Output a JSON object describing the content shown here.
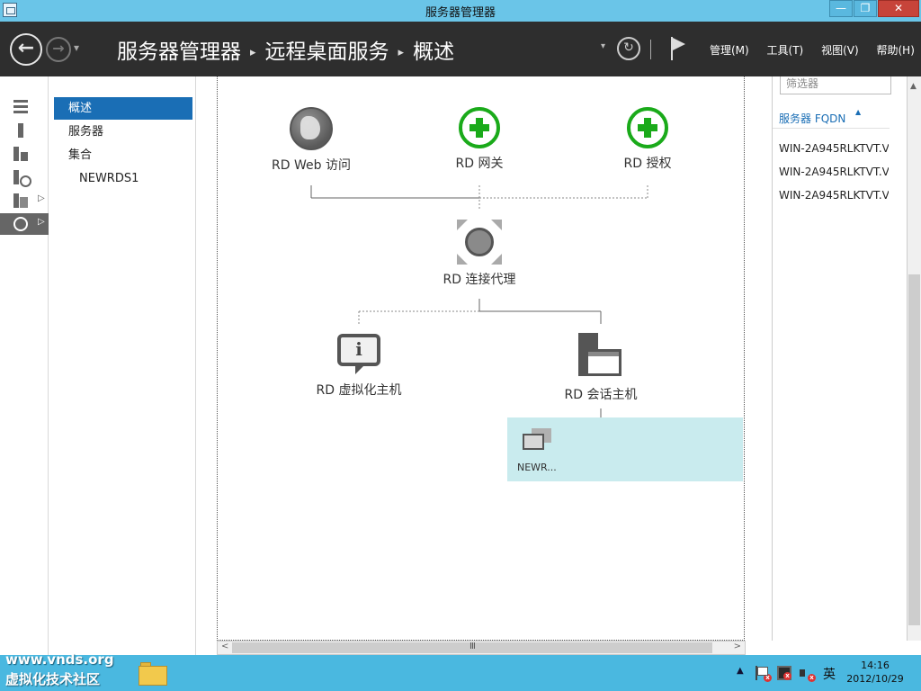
{
  "window": {
    "title": "服务器管理器",
    "min_glyph": "—",
    "restore_glyph": "❐",
    "close_glyph": "✕"
  },
  "header": {
    "back_glyph": "←",
    "forward_glyph": "→",
    "dropdown_glyph": "▾",
    "breadcrumb": [
      "服务器管理器",
      "远程桌面服务",
      "概述"
    ],
    "breadcrumb_sep": "▸",
    "refresh_glyph": "↻",
    "menus": [
      "管理(M)",
      "工具(T)",
      "视图(V)",
      "帮助(H)"
    ]
  },
  "sidebar": {
    "items": [
      {
        "name": "dashboard",
        "icon": "dashboard-icon"
      },
      {
        "name": "local-server",
        "icon": "server-icon"
      },
      {
        "name": "all-servers",
        "icon": "servers-icon"
      },
      {
        "name": "file-storage",
        "icon": "storage-icon",
        "arrow": "▷"
      },
      {
        "name": "iis",
        "icon": "folder-server-icon",
        "arrow": "▷"
      },
      {
        "name": "remote-desktop",
        "icon": "rds-icon",
        "arrow": "▷",
        "active": true
      }
    ]
  },
  "nav": {
    "items": [
      {
        "label": "概述",
        "selected": true
      },
      {
        "label": "服务器"
      },
      {
        "label": "集合"
      },
      {
        "label": "NEWRDS1",
        "child": true
      }
    ]
  },
  "diagram": {
    "web_access": "RD Web 访问",
    "gateway": "RD 网关",
    "licensing": "RD 授权",
    "broker": "RD 连接代理",
    "virtualization_host": "RD 虚拟化主机",
    "session_host": "RD 会话主机",
    "info_glyph": "i",
    "collection_label": "NEWR..."
  },
  "right_panel": {
    "filter_placeholder": "筛选器",
    "column_header": "服务器 FQDN",
    "sort_glyph": "▲",
    "rows": [
      "WIN-2A945RLKTVT.V",
      "WIN-2A945RLKTVT.V",
      "WIN-2A945RLKTVT.V"
    ]
  },
  "scroll": {
    "left_glyph": "<",
    "right_glyph": ">",
    "up_glyph": "▲",
    "grip_glyph": "Ⅲ"
  },
  "taskbar": {
    "watermark_line1": "www.vnds.org",
    "watermark_line2": "虚拟化技术社区",
    "tray_arrow": "▲",
    "tray_x": "x",
    "ime": "英",
    "time": "14:16",
    "date": "2012/10/29"
  },
  "colors": {
    "accent": "#1a6eb5",
    "titlebar": "#6ac5e8",
    "header": "#2e2e2e",
    "taskbar": "#4ab8e0",
    "collection_tile": "#c9ebee",
    "plus_green": "#1aaa1a"
  }
}
